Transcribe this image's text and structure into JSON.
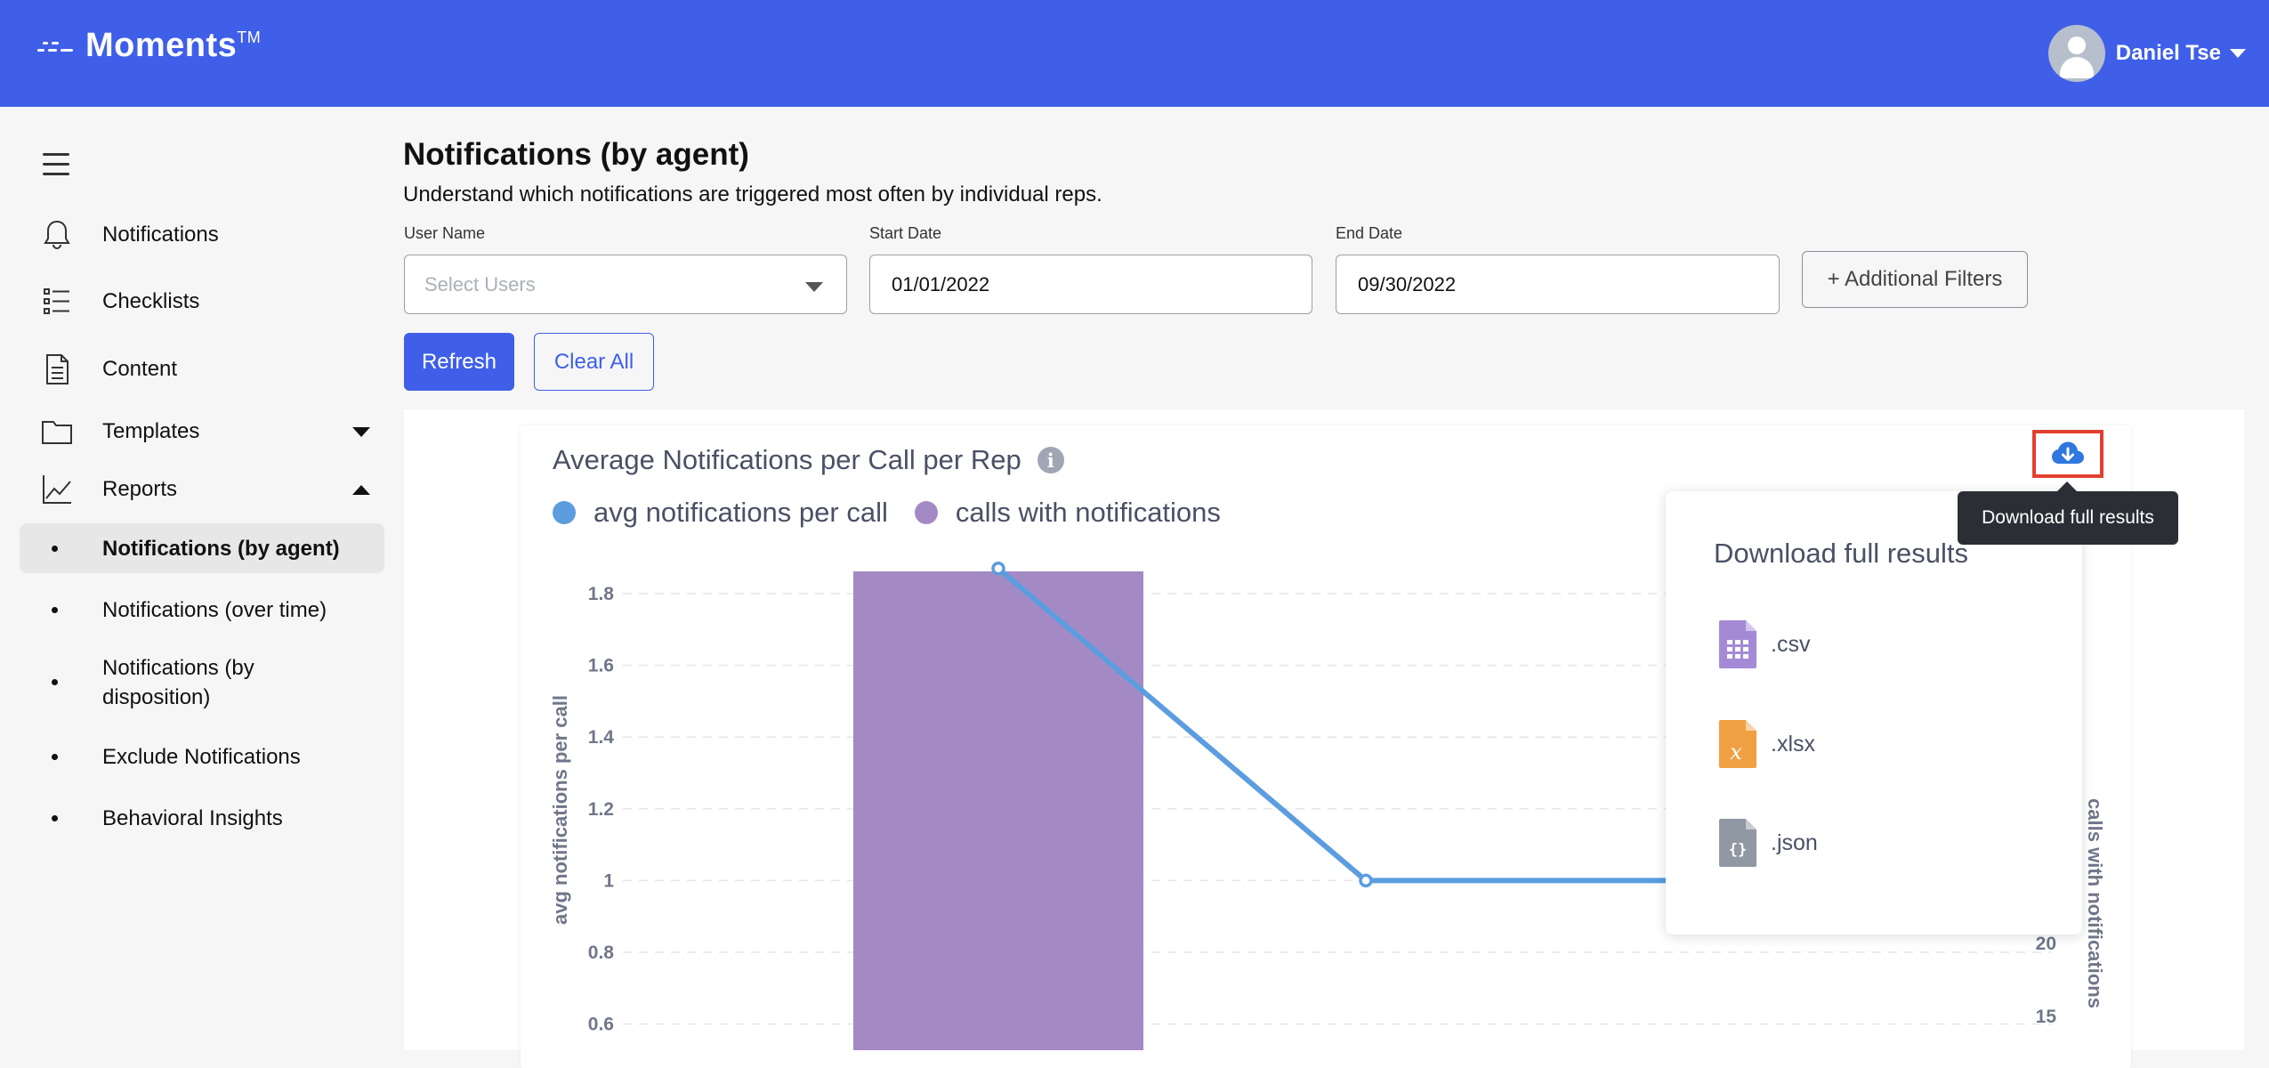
{
  "header": {
    "brand": "Moments",
    "trademark": "TM",
    "user_name": "Daniel Tse",
    "bar_color": "#3f5fe8"
  },
  "sidebar": {
    "items": [
      {
        "label": "Notifications",
        "icon": "bell-icon"
      },
      {
        "label": "Checklists",
        "icon": "checklist-icon"
      },
      {
        "label": "Content",
        "icon": "document-icon"
      },
      {
        "label": "Templates",
        "icon": "folder-icon",
        "expanded": false
      },
      {
        "label": "Reports",
        "icon": "line-chart-icon",
        "expanded": true
      }
    ],
    "report_subitems": [
      {
        "label": "Notifications (by agent)",
        "active": true
      },
      {
        "label": "Notifications (over time)",
        "active": false
      },
      {
        "label": "Notifications (by disposition)",
        "active": false
      },
      {
        "label": "Exclude Notifications",
        "active": false
      },
      {
        "label": "Behavioral Insights",
        "active": false
      }
    ]
  },
  "page": {
    "title": "Notifications (by agent)",
    "subtitle": "Understand which notifications are triggered most often by individual reps."
  },
  "filters": {
    "user_name_label": "User Name",
    "user_name_placeholder": "Select Users",
    "start_date_label": "Start Date",
    "start_date_value": "01/01/2022",
    "end_date_label": "End Date",
    "end_date_value": "09/30/2022",
    "additional_filters_label": "+ Additional Filters",
    "refresh_label": "Refresh",
    "clear_label": "Clear All"
  },
  "chart_data": {
    "type": "bar",
    "title": "Average Notifications per Call per Rep",
    "legend": [
      {
        "name": "avg notifications per call",
        "color": "#5b9ddf"
      },
      {
        "name": "calls with notifications",
        "color": "#a48ac4"
      }
    ],
    "ylabel": "avg notifications per call",
    "y2label": "calls with notifications",
    "yticks": [
      0.6,
      0.8,
      1,
      1.2,
      1.4,
      1.6,
      1.8
    ],
    "y2ticks": [
      15,
      20
    ],
    "grid": true,
    "line_series": {
      "name": "avg notifications per call",
      "values": [
        1.87,
        1.0,
        1.0
      ]
    },
    "bar_series": {
      "name": "calls with notifications"
    }
  },
  "download": {
    "tooltip": "Download full results",
    "panel_title": "Download full results",
    "options": [
      {
        "label": ".csv",
        "icon": "csv-file-icon",
        "color": "#a48ad6"
      },
      {
        "label": ".xlsx",
        "icon": "xlsx-file-icon",
        "color": "#f0a043"
      },
      {
        "label": ".json",
        "icon": "json-file-icon",
        "color": "#8f98a3"
      }
    ]
  }
}
